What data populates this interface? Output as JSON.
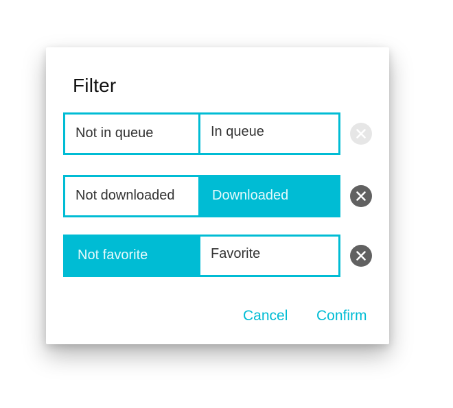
{
  "dialog": {
    "title": "Filter",
    "filters": [
      {
        "left_label": "Not in queue",
        "right_label": "In queue",
        "selected": "none",
        "clear_icon": "close-circle-icon",
        "clear_enabled": false
      },
      {
        "left_label": "Not downloaded",
        "right_label": "Downloaded",
        "selected": "right",
        "clear_icon": "close-circle-icon",
        "clear_enabled": true
      },
      {
        "left_label": "Not favorite",
        "right_label": "Favorite",
        "selected": "left",
        "clear_icon": "close-circle-icon",
        "clear_enabled": true
      }
    ],
    "actions": {
      "cancel_label": "Cancel",
      "confirm_label": "Confirm"
    }
  },
  "colors": {
    "accent": "#00bcd4",
    "clear_active": "#616161",
    "clear_disabled": "#e6e6e6"
  }
}
